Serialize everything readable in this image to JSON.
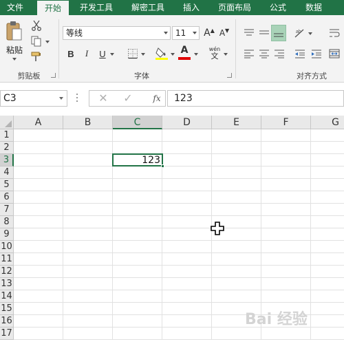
{
  "tabs": [
    {
      "label": "文件",
      "active": false
    },
    {
      "label": "开始",
      "active": true
    },
    {
      "label": "开发工具",
      "active": false
    },
    {
      "label": "解密工具",
      "active": false
    },
    {
      "label": "插入",
      "active": false
    },
    {
      "label": "页面布局",
      "active": false
    },
    {
      "label": "公式",
      "active": false
    },
    {
      "label": "数据",
      "active": false
    }
  ],
  "ribbon": {
    "clipboard": {
      "paste_label": "粘贴",
      "group_label": "剪贴板",
      "icons": [
        "paste-icon",
        "cut-icon",
        "copy-icon",
        "format-painter-icon"
      ]
    },
    "font": {
      "font_name": "等线",
      "font_size": "11",
      "grow_icon": "A",
      "shrink_icon": "A",
      "bold": "B",
      "italic": "I",
      "underline": "U",
      "font_color_letter": "A",
      "phonetic_label": "wén",
      "group_label": "字体",
      "fill_color": "#ffff00",
      "font_color": "#e00000"
    },
    "alignment": {
      "group_label": "对齐方式",
      "active_color": "#a9d3b8"
    }
  },
  "formula_bar": {
    "name_box": "C3",
    "cancel_symbol": "✕",
    "enter_symbol": "✓",
    "fx_label": "fx",
    "content": "123"
  },
  "grid": {
    "columns": [
      "A",
      "B",
      "C",
      "D",
      "E",
      "F",
      "G"
    ],
    "rows": [
      "1",
      "2",
      "3",
      "4",
      "5",
      "6",
      "7",
      "8",
      "9",
      "10",
      "11",
      "12",
      "13",
      "14",
      "15",
      "16",
      "17"
    ],
    "selected_column": "C",
    "selected_row": "3",
    "cells": {
      "C3": "123"
    }
  },
  "watermark": "Bai 经验",
  "colors": {
    "accent": "#217346",
    "ribbon_bg": "#f3f3f3",
    "gridline": "#e1e1e1"
  }
}
